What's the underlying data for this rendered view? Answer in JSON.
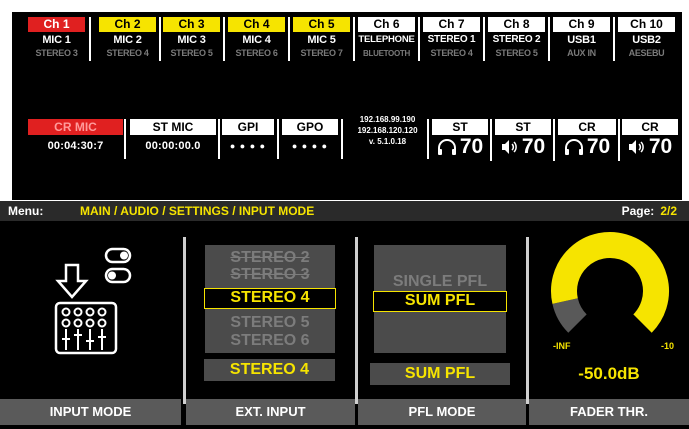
{
  "channels": [
    {
      "header": "Ch 1",
      "name": "MIC 1",
      "sub": "STEREO 3",
      "header_bg": "#e02020",
      "header_color": "#ffffff"
    },
    {
      "header": "Ch 2",
      "name": "MIC 2",
      "sub": "STEREO 4",
      "header_bg": "#f6e400",
      "header_color": "#000000"
    },
    {
      "header": "Ch 3",
      "name": "MIC 3",
      "sub": "STEREO 5",
      "header_bg": "#f6e400",
      "header_color": "#000000"
    },
    {
      "header": "Ch 4",
      "name": "MIC 4",
      "sub": "STEREO 6",
      "header_bg": "#f6e400",
      "header_color": "#000000"
    },
    {
      "header": "Ch 5",
      "name": "MIC 5",
      "sub": "STEREO 7",
      "header_bg": "#f6e400",
      "header_color": "#000000"
    },
    {
      "header": "Ch 6",
      "name": "TELEPHONE",
      "sub": "BLUETOOTH",
      "header_bg": "#ffffff",
      "header_color": "#000000"
    },
    {
      "header": "Ch 7",
      "name": "STEREO 1",
      "sub": "STEREO 4",
      "header_bg": "#ffffff",
      "header_color": "#000000"
    },
    {
      "header": "Ch 8",
      "name": "STEREO 2",
      "sub": "STEREO 5",
      "header_bg": "#ffffff",
      "header_color": "#000000"
    },
    {
      "header": "Ch 9",
      "name": "USB1",
      "sub": "AUX IN",
      "header_bg": "#ffffff",
      "header_color": "#000000"
    },
    {
      "header": "Ch 10",
      "name": "USB2",
      "sub": "AESEBU",
      "header_bg": "#ffffff",
      "header_color": "#000000"
    }
  ],
  "status": {
    "cr_mic": {
      "title": "CR MIC",
      "value": "00:04:30:7",
      "title_bg": "#e02020",
      "title_color": "#ff9a9a"
    },
    "st_mic": {
      "title": "ST MIC",
      "value": "00:00:00.0"
    },
    "gpi": {
      "title": "GPI",
      "value": "● ● ● ●"
    },
    "gpo": {
      "title": "GPO",
      "value": "● ● ● ●"
    },
    "network": {
      "ip1": "192.168.99.190",
      "ip2": "192.168.120.120",
      "version": "v. 5.1.0.18"
    },
    "levels": [
      {
        "title": "ST",
        "icon": "headphones-icon",
        "value": "70"
      },
      {
        "title": "ST",
        "icon": "speaker-icon",
        "value": "70"
      },
      {
        "title": "CR",
        "icon": "headphones-icon",
        "value": "70"
      },
      {
        "title": "CR",
        "icon": "speaker-icon",
        "value": "70"
      }
    ]
  },
  "menu": {
    "label": "Menu:",
    "path": "MAIN / AUDIO / SETTINGS / INPUT MODE",
    "page_label": "Page:",
    "page_value": "2/2"
  },
  "panels": {
    "input_mode": {
      "footer": "INPUT MODE",
      "icon": "input-mode-mixer-icon"
    },
    "ext_input": {
      "footer": "EXT. INPUT",
      "items": [
        "STEREO 2",
        "STEREO 3",
        "STEREO 4",
        "STEREO 5",
        "STEREO 6"
      ],
      "selected": "STEREO 4",
      "value": "STEREO 4"
    },
    "pfl_mode": {
      "footer": "PFL MODE",
      "items": [
        "SINGLE PFL",
        "SUM PFL"
      ],
      "selected": "SUM PFL",
      "value": "SUM PFL"
    },
    "fader_thr": {
      "footer": "FADER THR.",
      "min_label": "-INF",
      "max_label": "-10",
      "value": "-50.0dB",
      "gauge_fraction": 0.12
    }
  },
  "colors": {
    "accent": "#f6e400",
    "alert": "#e02020",
    "panel_gray": "#4b4b4b",
    "footer_gray": "#5a5a5a"
  }
}
